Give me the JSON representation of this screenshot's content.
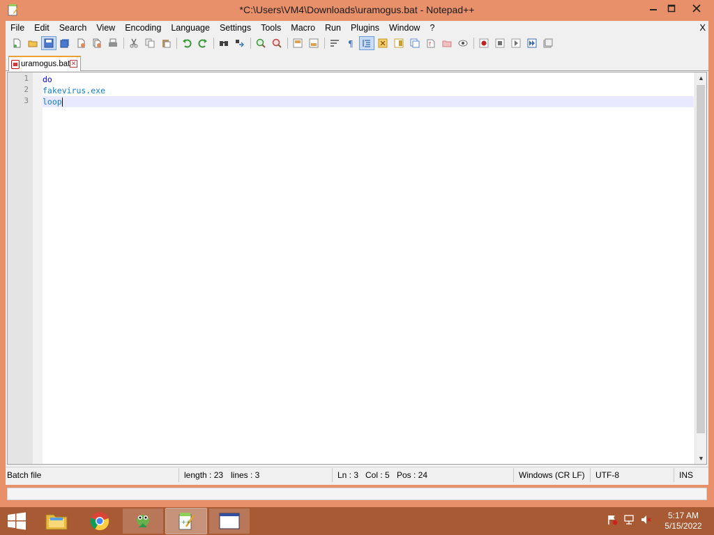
{
  "window": {
    "title": "*C:\\Users\\VM4\\Downloads\\uramogus.bat - Notepad++",
    "controls": {
      "minimize": "—",
      "maximize": "□",
      "close": "X"
    }
  },
  "menubar": {
    "items": [
      "File",
      "Edit",
      "Search",
      "View",
      "Encoding",
      "Language",
      "Settings",
      "Tools",
      "Macro",
      "Run",
      "Plugins",
      "Window",
      "?"
    ],
    "close": "X"
  },
  "toolbar": {
    "buttons": [
      {
        "name": "new-file-icon",
        "color": "#ffffff"
      },
      {
        "name": "open-file-icon",
        "color": "#f2c14e"
      },
      {
        "name": "save-icon",
        "color": "#4a7bd0"
      },
      {
        "name": "save-all-icon",
        "color": "#4a7bd0"
      },
      {
        "name": "close-file-icon",
        "color": "#e08a5a"
      },
      {
        "name": "close-all-icon",
        "color": "#e08a5a"
      },
      {
        "name": "print-icon",
        "color": "#808080"
      },
      {
        "name": "cut-icon",
        "color": "#9aa0aa"
      },
      {
        "name": "copy-icon",
        "color": "#9aa0aa"
      },
      {
        "name": "paste-icon",
        "color": "#b89060"
      },
      {
        "name": "undo-icon",
        "color": "#3a9a3a"
      },
      {
        "name": "redo-icon",
        "color": "#3a9a3a"
      },
      {
        "name": "find-icon",
        "color": "#404040"
      },
      {
        "name": "replace-icon",
        "color": "#3a7bc0"
      },
      {
        "name": "zoom-in-icon",
        "color": "#3a9a3a"
      },
      {
        "name": "zoom-out-icon",
        "color": "#c04040"
      },
      {
        "name": "sync-vertical-icon",
        "color": "#e0a050"
      },
      {
        "name": "sync-horizontal-icon",
        "color": "#e0a050"
      },
      {
        "name": "word-wrap-icon",
        "color": "#505050"
      },
      {
        "name": "show-all-chars-icon",
        "color": "#3a6ab0"
      },
      {
        "name": "indent-guide-icon",
        "color": "#3a6ab0"
      },
      {
        "name": "user-lang-icon",
        "color": "#e0a030"
      },
      {
        "name": "doc-map-icon",
        "color": "#c8a030"
      },
      {
        "name": "function-list-icon",
        "color": "#5a8ad0"
      },
      {
        "name": "folder-as-workspace-icon",
        "color": "#d05050"
      },
      {
        "name": "monitoring-icon",
        "color": "#d08080"
      },
      {
        "name": "eye-icon",
        "color": "#707070"
      },
      {
        "name": "record-macro-icon",
        "color": "#c02020"
      },
      {
        "name": "stop-record-icon",
        "color": "#707070"
      },
      {
        "name": "play-macro-icon",
        "color": "#707070"
      },
      {
        "name": "run-macro-multiple-icon",
        "color": "#3a6ab0"
      },
      {
        "name": "save-macro-icon",
        "color": "#707070"
      }
    ]
  },
  "tab": {
    "label": "uramogus.bat",
    "close": "✕"
  },
  "editor": {
    "lines": [
      {
        "num": "1",
        "text": "do",
        "style": "kw"
      },
      {
        "num": "2",
        "text": "fakevirus.exe",
        "style": "cmd"
      },
      {
        "num": "3",
        "text": "loop",
        "style": "cmd"
      }
    ],
    "current_line": 3
  },
  "statusbar": {
    "file_type": "Batch file",
    "length": "length : 23",
    "lines": "lines : 3",
    "ln": "Ln : 3",
    "col": "Col : 5",
    "pos": "Pos : 24",
    "eol": "Windows (CR LF)",
    "encoding": "UTF-8",
    "mode": "INS"
  },
  "taskbar": {
    "apps": [
      "file-explorer",
      "chrome",
      "gecko-app",
      "notepad-plus-plus",
      "window-app"
    ],
    "clock": {
      "time": "5:17 AM",
      "date": "5/15/2022"
    }
  },
  "colors": {
    "accent": "#e8906a",
    "taskbar": "#a85a34",
    "current_line": "#e8e8ff",
    "keyword": "#0000ff",
    "command": "#1080c8"
  }
}
